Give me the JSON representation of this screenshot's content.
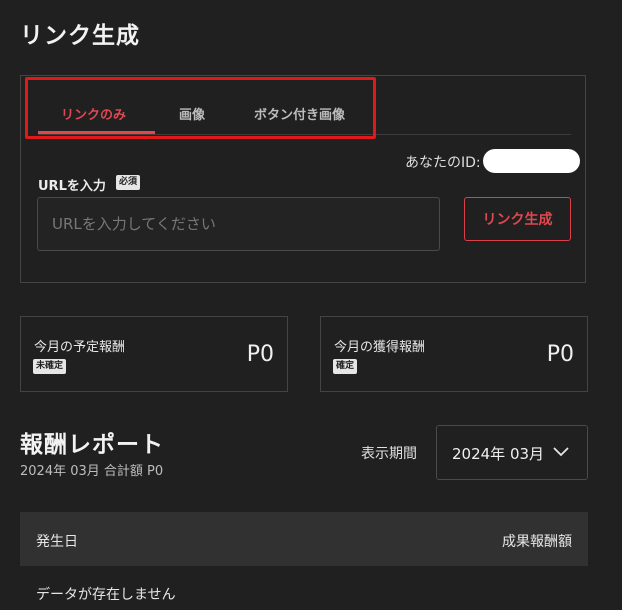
{
  "page": {
    "title": "リンク生成"
  },
  "tabs": [
    {
      "label": "リンクのみ",
      "active": true
    },
    {
      "label": "画像",
      "active": false
    },
    {
      "label": "ボタン付き画像",
      "active": false
    }
  ],
  "colors": {
    "accent": "#e04850",
    "highlight_box": "#e0191a",
    "background": "#202020"
  },
  "account": {
    "id_label": "あなたのID:"
  },
  "url_form": {
    "label": "URLを入力",
    "required_badge": "必須",
    "placeholder": "URLを入力してください",
    "value": "",
    "generate_button": "リンク生成"
  },
  "stats": {
    "planned": {
      "label": "今月の予定報酬",
      "badge": "未確定",
      "value": "P0"
    },
    "earned": {
      "label": "今月の獲得報酬",
      "badge": "確定",
      "value": "P0"
    }
  },
  "report": {
    "title": "報酬レポート",
    "summary": "2024年 03月 合計額 P0",
    "period_label": "表示期間",
    "period_value": "2024年 03月",
    "period_icon": "chevron-down-icon",
    "columns": {
      "date": "発生日",
      "amount": "成果報酬額"
    },
    "empty_text": "データが存在しません"
  }
}
